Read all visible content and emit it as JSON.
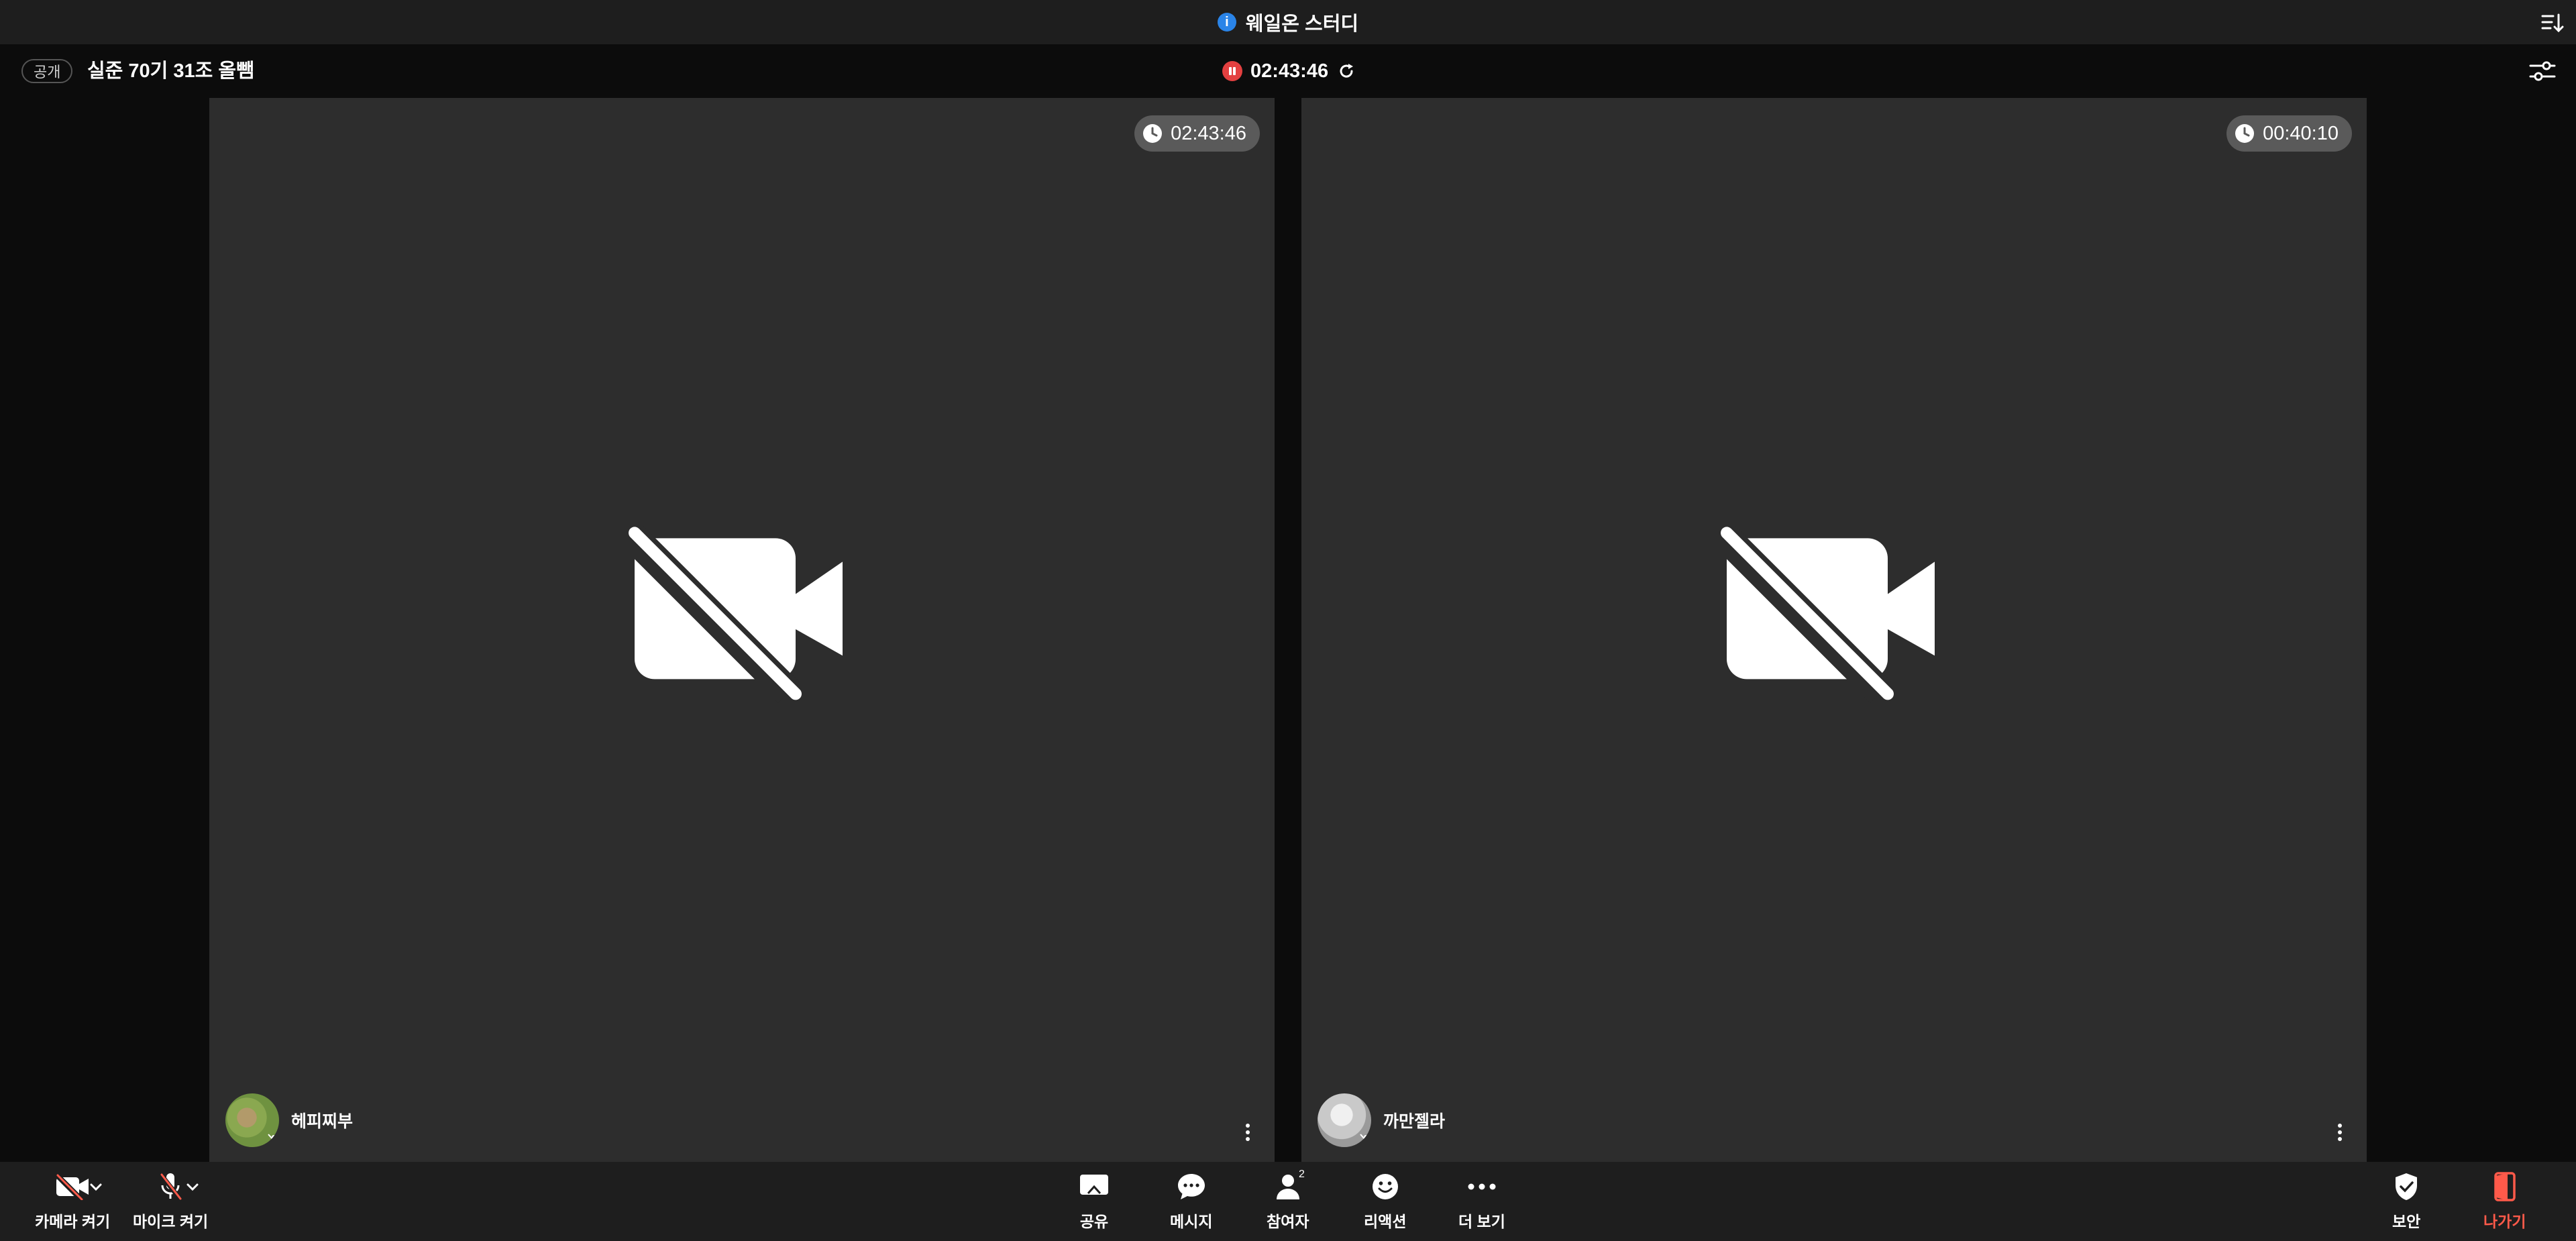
{
  "window": {
    "title": "웨일온 스터디",
    "icons": {
      "info": "info-icon",
      "sort": "sort-icon"
    }
  },
  "meeting": {
    "visibility": "공개",
    "title": "실준 70기 31조 올뺌",
    "recording_time": "02:43:46"
  },
  "participants": [
    {
      "name": "헤피찌부",
      "timer": "02:43:46",
      "camera": "off",
      "mic": "off"
    },
    {
      "name": "까만젤라",
      "timer": "00:40:10",
      "camera": "off",
      "mic": "off"
    }
  ],
  "toolbar": {
    "camera_label": "카메라 켜기",
    "mic_label": "마이크 켜기",
    "share_label": "공유",
    "message_label": "메시지",
    "participants_label": "참여자",
    "participants_count": "2",
    "reaction_label": "리액션",
    "more_label": "더 보기",
    "security_label": "보안",
    "leave_label": "나가기"
  },
  "colors": {
    "accent_blue": "#2a84e8",
    "record_red": "#e34040",
    "leave_red": "#ff5a4a",
    "tile_bg": "#2d2d2d",
    "bar_bg": "#1e1e1e"
  }
}
